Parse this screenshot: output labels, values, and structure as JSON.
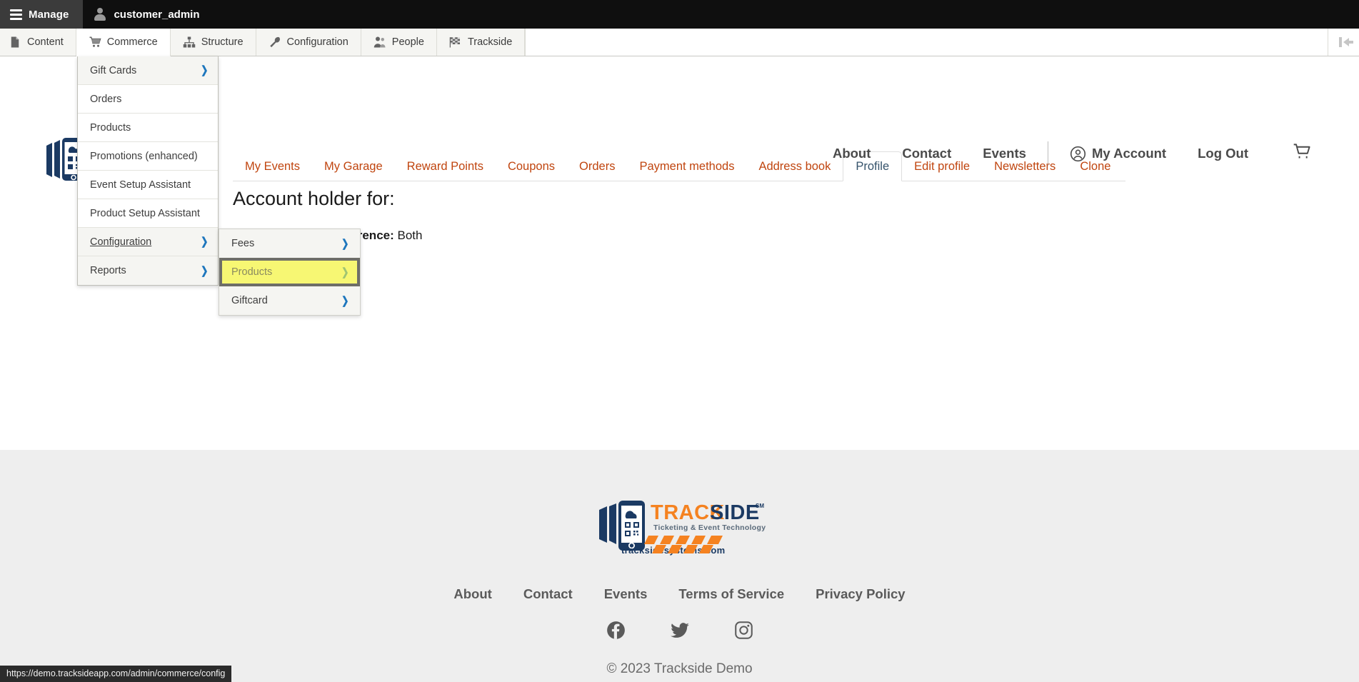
{
  "admin_toolbar": {
    "manage_label": "Manage",
    "manage_icon": "hamburger-icon",
    "user_name": "customer_admin",
    "user_icon": "person-icon"
  },
  "admin_menubar": {
    "items": [
      {
        "label": "Content",
        "icon": "page-icon",
        "active": false
      },
      {
        "label": "Commerce",
        "icon": "cart-icon",
        "active": true
      },
      {
        "label": "Structure",
        "icon": "sitemap-icon",
        "active": false
      },
      {
        "label": "Configuration",
        "icon": "wrench-icon",
        "active": false
      },
      {
        "label": "People",
        "icon": "people-icon",
        "active": false
      },
      {
        "label": "Trackside",
        "icon": "checkered-flag-icon",
        "active": false
      }
    ],
    "collapse_icon": "collapse-left-icon"
  },
  "commerce_menu": {
    "items": [
      {
        "label": "Gift Cards",
        "has_submenu": true,
        "shaded": true,
        "trail": false
      },
      {
        "label": "Orders",
        "has_submenu": false,
        "shaded": false,
        "trail": false
      },
      {
        "label": "Products",
        "has_submenu": false,
        "shaded": false,
        "trail": false
      },
      {
        "label": "Promotions (enhanced)",
        "has_submenu": false,
        "shaded": false,
        "trail": false
      },
      {
        "label": "Event Setup Assistant",
        "has_submenu": false,
        "shaded": false,
        "trail": false
      },
      {
        "label": "Product Setup Assistant",
        "has_submenu": false,
        "shaded": false,
        "trail": false
      },
      {
        "label": "Configuration",
        "has_submenu": true,
        "shaded": true,
        "trail": true
      },
      {
        "label": "Reports",
        "has_submenu": true,
        "shaded": true,
        "trail": false
      }
    ],
    "caret_glyph": "❯",
    "caret_color": "#1d76bd"
  },
  "config_submenu": {
    "items": [
      {
        "label": "Fees",
        "has_submenu": true,
        "highlighted": false
      },
      {
        "label": "Products",
        "has_submenu": true,
        "highlighted": true
      },
      {
        "label": "Giftcard",
        "has_submenu": true,
        "highlighted": false
      }
    ],
    "highlight_color": "#f7f773",
    "highlight_border": "#6e6e68"
  },
  "site_header": {
    "logo_alt": "Trackside phone QR logo",
    "nav": [
      {
        "label": "About",
        "kind": "link"
      },
      {
        "label": "Contact",
        "kind": "link"
      },
      {
        "label": "Events",
        "kind": "link"
      }
    ],
    "account_label": "My Account",
    "account_icon": "user-circle-icon",
    "logout_label": "Log Out",
    "cart_icon": "shopping-cart-icon"
  },
  "tabs": [
    {
      "label": "My Events",
      "active": false
    },
    {
      "label": "My Garage",
      "active": false
    },
    {
      "label": "Reward Points",
      "active": false
    },
    {
      "label": "Coupons",
      "active": false
    },
    {
      "label": "Orders",
      "active": false
    },
    {
      "label": "Payment methods",
      "active": false
    },
    {
      "label": "Address book",
      "active": false
    },
    {
      "label": "Profile",
      "active": true
    },
    {
      "label": "Edit profile",
      "active": false
    },
    {
      "label": "Newsletters",
      "active": false
    },
    {
      "label": "Clone",
      "active": false
    }
  ],
  "content": {
    "heading": "Account holder for:",
    "preference_label": "Communication preference:",
    "preference_value": "Both"
  },
  "footer": {
    "logo_wordmark_track": "TRACK",
    "logo_wordmark_side": "SIDE",
    "logo_sm": "SM",
    "logo_tagline": "Ticketing & Event Technology",
    "logo_url": "tracksidesystems.com",
    "links": [
      {
        "label": "About"
      },
      {
        "label": "Contact"
      },
      {
        "label": "Events"
      },
      {
        "label": "Terms of Service"
      },
      {
        "label": "Privacy Policy"
      }
    ],
    "social": [
      {
        "name": "facebook-icon"
      },
      {
        "name": "twitter-icon"
      },
      {
        "name": "instagram-icon"
      }
    ],
    "copyright": "© 2023 Trackside Demo"
  },
  "status_bar": {
    "url": "https://demo.tracksideapp.com/admin/commerce/config"
  },
  "colors": {
    "brand_orange": "#f58220",
    "brand_navy": "#1b3a63",
    "tab_link": "#c0450f",
    "highlight_yellow": "#f7f773",
    "toolbar_black": "#0f0f0f",
    "footer_bg": "#eeeeee"
  }
}
